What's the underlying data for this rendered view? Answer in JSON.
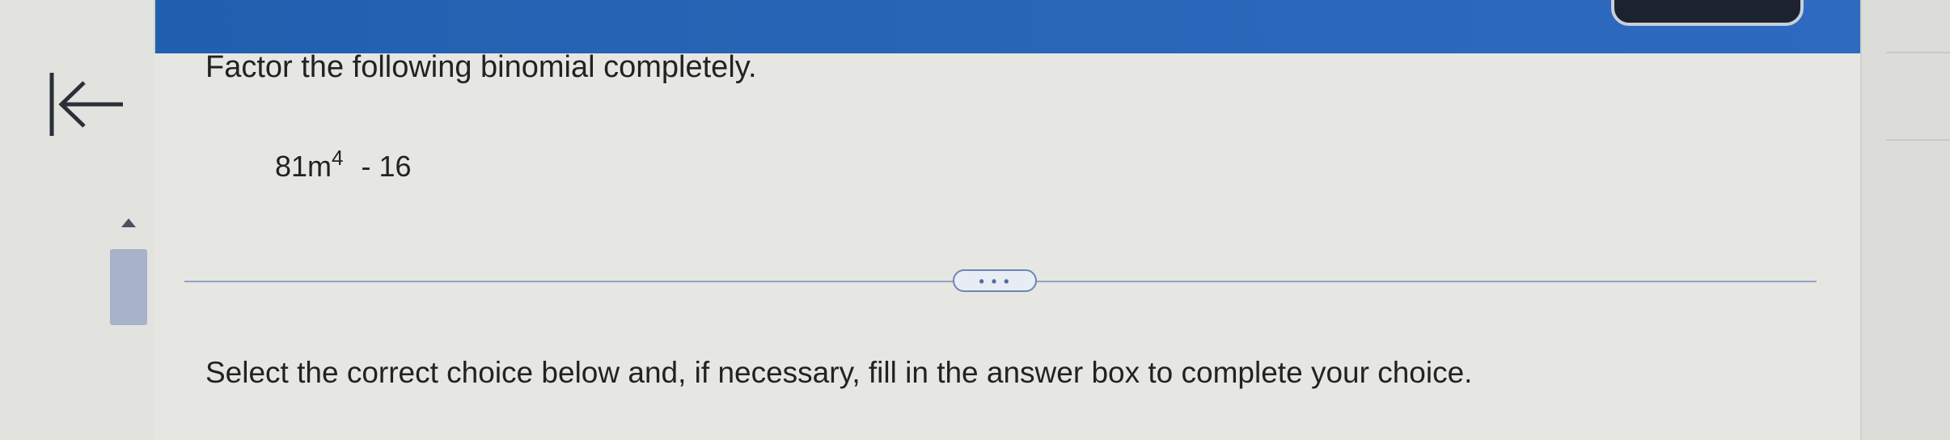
{
  "question": {
    "instruction": "Factor the following binomial completely.",
    "expression": {
      "coefficient_base": "81m",
      "exponent": "4",
      "operator": "-",
      "constant": "16"
    }
  },
  "expand_button": {
    "label": "• • •"
  },
  "answer_prompt": "Select the correct choice below and, if necessary, fill in the answer box to complete your choice.",
  "icons": {
    "back": "back-to-start-icon",
    "scroll_up": "scroll-up-arrow-icon"
  },
  "colors": {
    "header": "#2a66b8",
    "divider": "#8fa2c2",
    "accent": "#4f6aa0"
  }
}
